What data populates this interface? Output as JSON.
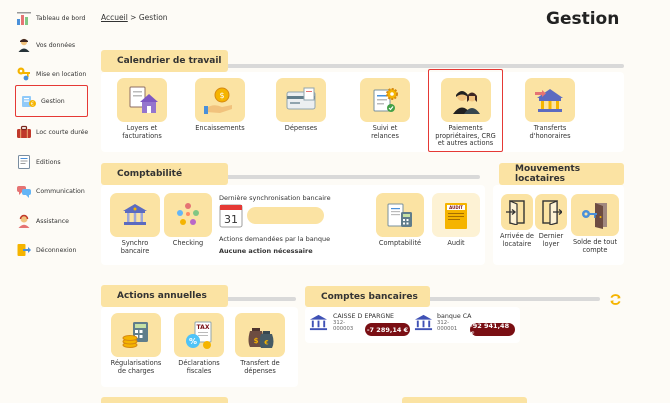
{
  "sidebar": {
    "items": [
      {
        "label": "Tableau de bord",
        "icon": "dashboard-icon"
      },
      {
        "label": "Vos données",
        "icon": "user-icon"
      },
      {
        "label": "Mise en location",
        "icon": "keys-icon"
      },
      {
        "label": "Gestion",
        "icon": "management-icon"
      },
      {
        "label": "Loc courte durée",
        "icon": "suitcase-icon"
      },
      {
        "label": "Editions",
        "icon": "document-icon"
      },
      {
        "label": "Communication",
        "icon": "chat-icon"
      },
      {
        "label": "Assistance",
        "icon": "support-icon"
      },
      {
        "label": "Déconnexion",
        "icon": "logout-icon"
      }
    ]
  },
  "header": {
    "breadcrumb_home": "Accueil",
    "breadcrumb_sep": ">",
    "breadcrumb_current": "Gestion",
    "title": "Gestion"
  },
  "calendrier": {
    "title": "Calendrier de travail",
    "tiles": [
      {
        "line1": "Loyers et",
        "line2": "facturations",
        "line3": ""
      },
      {
        "line1": "Encaissements",
        "line2": "",
        "line3": ""
      },
      {
        "line1": "Dépenses",
        "line2": "",
        "line3": ""
      },
      {
        "line1": "Suivi et",
        "line2": "relances",
        "line3": ""
      },
      {
        "line1": "Paiements",
        "line2": "propriétaires, CRG",
        "line3": "et autres actions"
      },
      {
        "line1": "Transferts",
        "line2": "d'honoraires",
        "line3": ""
      }
    ]
  },
  "comptabilite": {
    "title": "Comptabilité",
    "synchro": {
      "line1": "Synchro",
      "line2": "bancaire"
    },
    "checking": "Checking",
    "sync_title": "Dernière synchronisation bancaire",
    "calendar_day": "31",
    "actions_title": "Actions demandées par la banque",
    "actions_value": "Aucune action nécessaire",
    "compta": "Comptabilité",
    "audit": "Audit",
    "audit_tag": "AUDIT"
  },
  "mouvements": {
    "title": "Mouvements locataires",
    "tiles": [
      {
        "line1": "Arrivée de",
        "line2": "locataire"
      },
      {
        "line1": "Dernier",
        "line2": "loyer"
      },
      {
        "line1": "Solde de tout",
        "line2": "compte"
      }
    ]
  },
  "actions_annuelles": {
    "title": "Actions annuelles",
    "tiles": [
      {
        "line1": "Régularisations",
        "line2": "de charges"
      },
      {
        "line1": "Déclarations",
        "line2": "fiscales",
        "tag": "TAX"
      },
      {
        "line1": "Transfert de",
        "line2": "dépenses"
      }
    ]
  },
  "comptes": {
    "title": "Comptes bancaires",
    "banks": [
      {
        "name": "CAISSE D EPARGNE",
        "num1": "312-",
        "num2": "000003",
        "balance": "-7 289,14 €"
      },
      {
        "name": "banque CA",
        "num1": "312-",
        "num2": "000001",
        "balance": "-92 941,48 €"
      }
    ]
  },
  "colors": {
    "accent": "#fbe3a3",
    "badge": "#7a0f14",
    "highlight": "#e53935"
  }
}
